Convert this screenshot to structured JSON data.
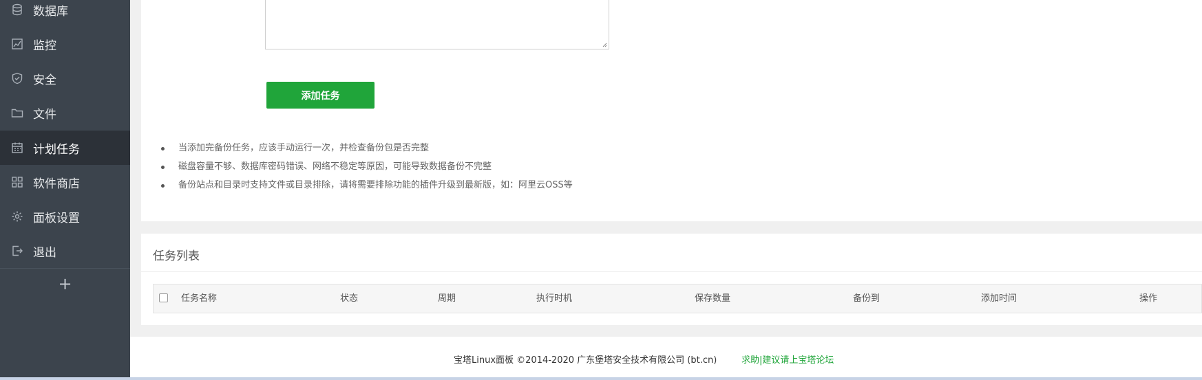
{
  "sidebar": {
    "items": [
      {
        "label": "数据库",
        "icon": "database-icon"
      },
      {
        "label": "监控",
        "icon": "monitor-icon"
      },
      {
        "label": "安全",
        "icon": "shield-icon"
      },
      {
        "label": "文件",
        "icon": "folder-icon"
      },
      {
        "label": "计划任务",
        "icon": "calendar-icon",
        "active": true
      },
      {
        "label": "软件商店",
        "icon": "apps-grid-icon"
      },
      {
        "label": "面板设置",
        "icon": "gear-icon"
      },
      {
        "label": "退出",
        "icon": "logout-icon"
      }
    ],
    "add_label": "+"
  },
  "form": {
    "add_task_label": "添加任务"
  },
  "tips": [
    "当添加完备份任务，应该手动运行一次，并检查备份包是否完整",
    "磁盘容量不够、数据库密码错误、网络不稳定等原因，可能导致数据备份不完整",
    "备份站点和目录时支持文件或目录排除，请将需要排除功能的插件升级到最新版，如：阿里云OSS等"
  ],
  "task_list": {
    "title": "任务列表",
    "columns": [
      "任务名称",
      "状态",
      "周期",
      "执行时机",
      "保存数量",
      "备份到",
      "添加时间",
      "操作"
    ]
  },
  "footer": {
    "copyright": "宝塔Linux面板 ©2014-2020 广东堡塔安全技术有限公司 (bt.cn)",
    "help_link": "求助|建议请上宝塔论坛"
  },
  "colors": {
    "sidebar_bg": "#3c444d",
    "sidebar_active": "#2c3138",
    "accent_green": "#20a53a"
  }
}
